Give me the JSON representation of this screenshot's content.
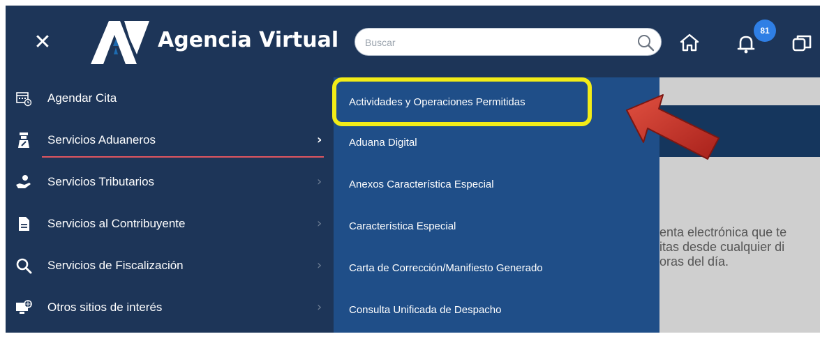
{
  "header": {
    "close_icon": "close-icon",
    "brand_name": "Agencia Virtual",
    "search_placeholder": "Buscar",
    "notifications_count": "81"
  },
  "sidebar": {
    "items": [
      {
        "label": "Agendar Cita",
        "icon": "calendar-clock-icon"
      },
      {
        "label": "Servicios Aduaneros",
        "icon": "customs-officer-icon"
      },
      {
        "label": "Servicios Tributarios",
        "icon": "hand-coins-icon"
      },
      {
        "label": "Servicios al Contribuyente",
        "icon": "document-icon"
      },
      {
        "label": "Servicios de Fiscalización",
        "icon": "search-icon"
      },
      {
        "label": "Otros sitios de interés",
        "icon": "monitor-globe-icon"
      }
    ],
    "active_index": 1
  },
  "submenu": {
    "items": [
      "Actividades y Operaciones Permitidas",
      "Aduana Digital",
      "Anexos Característica Especial",
      "Característica Especial",
      "Carta de Corrección/Manifiesto Generado",
      "Consulta Unificada de Despacho"
    ],
    "highlighted_index": 0
  },
  "content": {
    "text_lines": [
      "enta electrónica que te",
      "itas desde cualquier di",
      "oras del día."
    ]
  },
  "colors": {
    "nav_bg": "#1d3558",
    "submenu_bg": "#1f4e88",
    "highlight": "#f2ec17",
    "arrow": "#c8322b",
    "badge": "#2f7fe5"
  }
}
